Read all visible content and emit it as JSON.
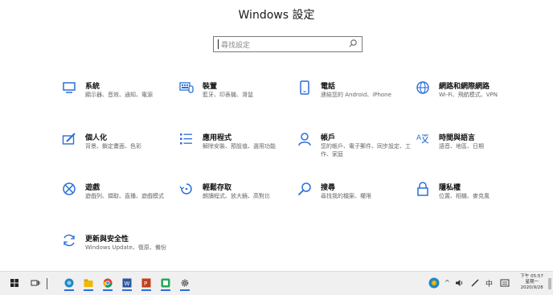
{
  "window": {
    "title": "Windows 設定"
  },
  "search": {
    "placeholder": "尋找設定"
  },
  "categories": [
    {
      "name": "系統",
      "desc": "顯示器、音效、通知、電源",
      "icon": "display-icon"
    },
    {
      "name": "裝置",
      "desc": "藍牙、印表機、滑鼠",
      "icon": "devices-icon"
    },
    {
      "name": "電話",
      "desc": "連結您的 Android、iPhone",
      "icon": "phone-icon"
    },
    {
      "name": "網路和網際網路",
      "desc": "Wi-Fi、飛航模式、VPN",
      "icon": "globe-icon"
    },
    {
      "name": "個人化",
      "desc": "背景、鎖定畫面、色彩",
      "icon": "personalization-icon"
    },
    {
      "name": "應用程式",
      "desc": "解除安裝、預設值、選用功能",
      "icon": "apps-list-icon"
    },
    {
      "name": "帳戶",
      "desc": "您的帳戶、電子郵件、同步設定、工作、家庭",
      "icon": "person-icon"
    },
    {
      "name": "時間與語言",
      "desc": "語音、地區、日期",
      "icon": "time-language-icon"
    },
    {
      "name": "遊戲",
      "desc": "遊戲列、擷取、直播、遊戲模式",
      "icon": "xbox-icon"
    },
    {
      "name": "輕鬆存取",
      "desc": "朗讀程式、放大鏡、高對比",
      "icon": "ease-of-access-icon"
    },
    {
      "name": "搜尋",
      "desc": "尋找我的檔案、權限",
      "icon": "search-icon"
    },
    {
      "name": "隱私權",
      "desc": "位置、相機、麥克風",
      "icon": "lock-icon"
    },
    {
      "name": "更新與安全性",
      "desc": "Windows Update、復原、備份",
      "icon": "update-icon"
    }
  ],
  "taskbar": {
    "time": "下午 05:57",
    "day": "星期一",
    "date": "2020/9/28",
    "ime": "中",
    "accent": "#2a6fd6"
  }
}
